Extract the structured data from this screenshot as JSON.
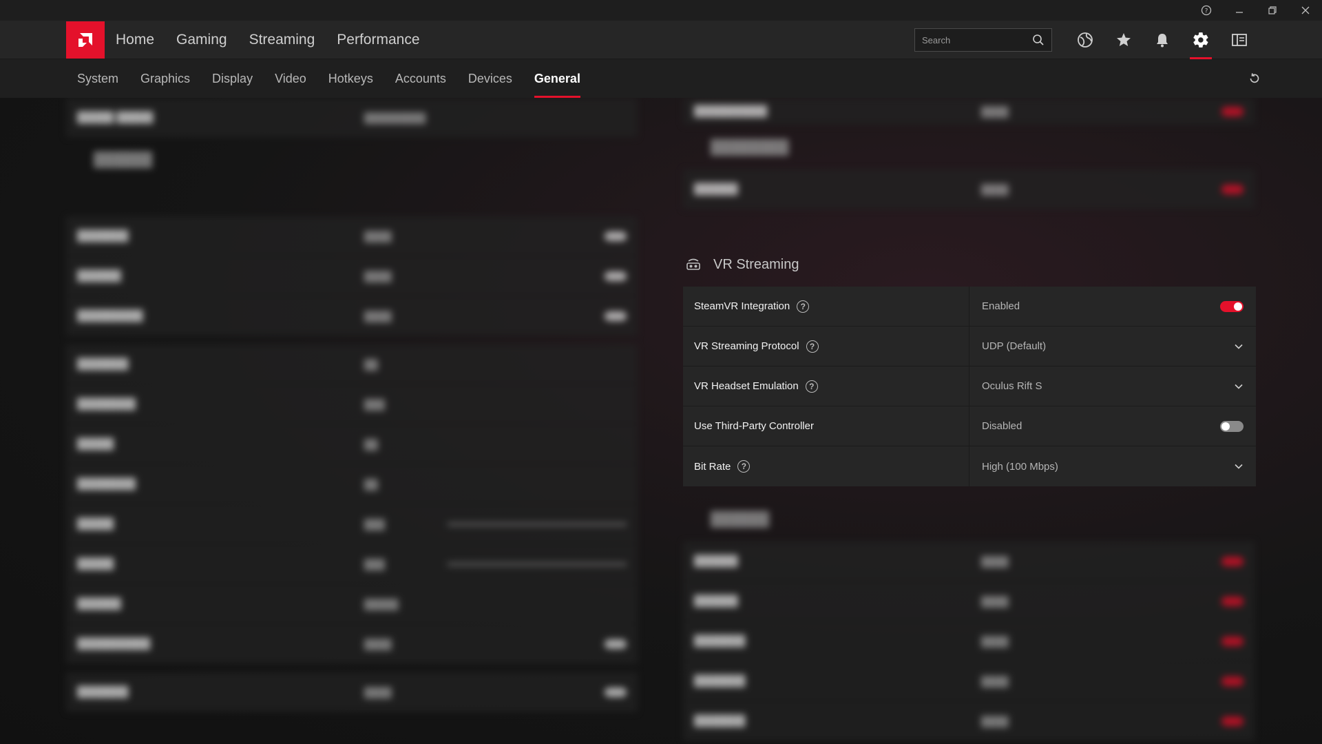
{
  "header": {
    "nav": [
      "Home",
      "Gaming",
      "Streaming",
      "Performance"
    ],
    "search_placeholder": "Search"
  },
  "subnav": {
    "items": [
      "System",
      "Graphics",
      "Display",
      "Video",
      "Hotkeys",
      "Accounts",
      "Devices",
      "General"
    ],
    "active": "General"
  },
  "vr_streaming": {
    "title": "VR Streaming",
    "rows": [
      {
        "label": "SteamVR Integration",
        "value": "Enabled",
        "help": true,
        "control": "toggle-on"
      },
      {
        "label": "VR Streaming Protocol",
        "value": "UDP (Default)",
        "help": true,
        "control": "dropdown"
      },
      {
        "label": "VR Headset Emulation",
        "value": "Oculus Rift S",
        "help": true,
        "control": "dropdown"
      },
      {
        "label": "Use Third-Party Controller",
        "value": "Disabled",
        "help": false,
        "control": "toggle-off"
      },
      {
        "label": "Bit Rate",
        "value": "High (100 Mbps)",
        "help": true,
        "control": "dropdown"
      }
    ]
  },
  "colors": {
    "accent": "#e4112b",
    "panel": "#262626",
    "background": "#141414"
  }
}
